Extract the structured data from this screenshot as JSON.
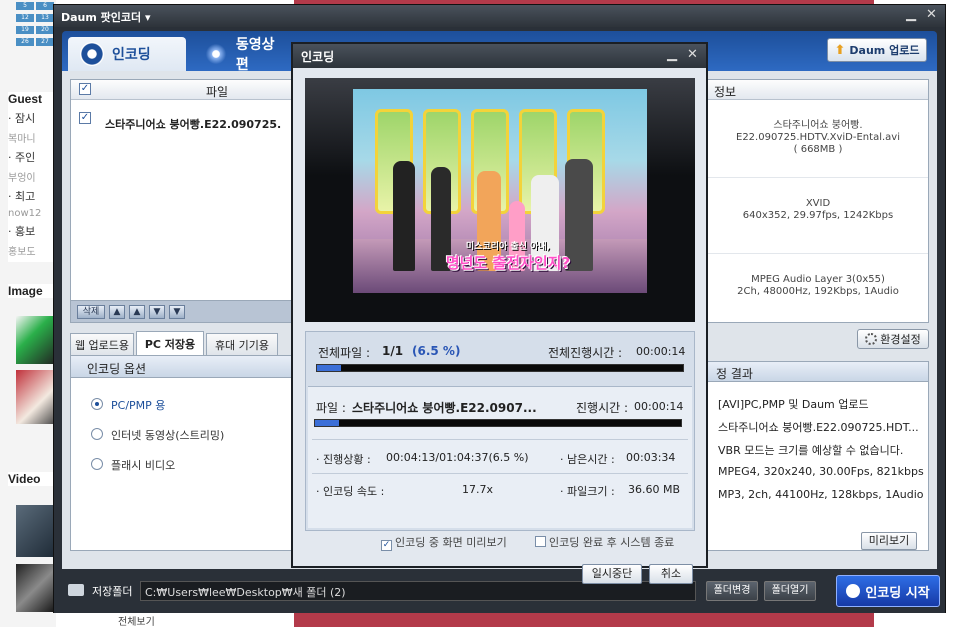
{
  "background": {
    "calendar": [
      "5",
      "6",
      "12",
      "13",
      "19",
      "20",
      "26",
      "27"
    ],
    "sections": [
      {
        "heading": "Guest",
        "lines": [
          "· 잠시",
          "복마니",
          "· 주인",
          "부엉이",
          "· 최고",
          "now12",
          "· 홍보",
          "홍보도"
        ]
      },
      {
        "heading": "Image",
        "lines": []
      },
      {
        "heading": "Video",
        "lines": []
      }
    ],
    "bottom_text": "전체보기"
  },
  "app": {
    "title": "Daum 팟인코더 ▾",
    "tabs": [
      {
        "label": "인코딩",
        "active": true
      },
      {
        "label": "동영상 편",
        "active": false
      }
    ],
    "upload_button": "Daum 업로드",
    "file_list": {
      "header": "파일",
      "files": [
        {
          "name": "스타주니어쇼 붕어빵.E22.090725."
        }
      ],
      "tool_buttons": [
        "삭제",
        "▲",
        "▲",
        "▼",
        "▼"
      ]
    },
    "info_panel": {
      "header": "정보",
      "cells": [
        "스타주니어쇼 붕어빵.\nE22.090725.HDTV.XviD-Ental.avi\n( 668MB )",
        "XVID\n640x352, 29.97fps, 1242Kbps",
        "MPEG Audio Layer 3(0x55)\n2Ch, 48000Hz, 192Kbps, 1Audio"
      ]
    },
    "settings_button": "환경설정",
    "option_tabs": [
      "웹 업로드용",
      "PC 저장용",
      "휴대 기기용"
    ],
    "active_option_tab": "PC 저장용",
    "options": {
      "header": "인코딩 옵션",
      "items": [
        {
          "label": "PC/PMP 용",
          "selected": true
        },
        {
          "label": "인터넷 동영상(스트리밍)",
          "selected": false
        },
        {
          "label": "플래시 비디오",
          "selected": false
        }
      ]
    },
    "result": {
      "header": "정 결과",
      "lines": [
        "[AVI]PC,PMP 및 Daum 업로드",
        "스타주니어쇼 붕어빵.E22.090725.HDT...",
        "VBR 모드는 크기를 예상할 수 없습니다.",
        "MPEG4, 320x240, 30.00Fps, 821kbps",
        "MP3, 2ch, 44100Hz, 128kbps, 1Audio"
      ],
      "preview_button": "미리보기"
    },
    "save_folder_label": "저장폴더",
    "save_path": "C:₩Users₩lee₩Desktop₩새 폴더 (2)",
    "change_folder_button": "폴더변경",
    "open_folder_button": "폴더열기",
    "start_button": "인코딩 시작",
    "minimize": "▁",
    "close": "✕"
  },
  "dialog": {
    "title": "인코딩",
    "minimize": "▁",
    "close": "✕",
    "video_caption_small": "미스코리아 출신 아내,",
    "video_caption": "명년도 출전자인지?",
    "total_file_label": "전체파일 :",
    "total_file_value": "1/1",
    "total_percent": "(6.5 %)",
    "total_time_label": "전체진행시간 :",
    "total_time_value": "00:00:14",
    "total_progress": 0.065,
    "file_label": "파일 :",
    "file_name": "스타주니어쇼 붕어빵.E22.0907...",
    "file_time_label": "진행시간 :",
    "file_time_value": "00:00:14",
    "file_progress": 0.065,
    "status_label": "· 진행상황 :",
    "status_value": "00:04:13/01:04:37(6.5 %)",
    "remaining_label": "· 남은시간 :",
    "remaining_value": "00:03:34",
    "speed_label": "· 인코딩 속도 :",
    "speed_value": "17.7x",
    "filesize_label": "· 파일크기 :",
    "filesize_value": "36.60 MB",
    "preview_checkbox": "인코딩 중 화면 미리보기",
    "preview_checked": true,
    "shutdown_checkbox": "인코딩 완료 후 시스템 종료",
    "shutdown_checked": false,
    "pause_button": "일시중단",
    "cancel_button": "취소"
  }
}
